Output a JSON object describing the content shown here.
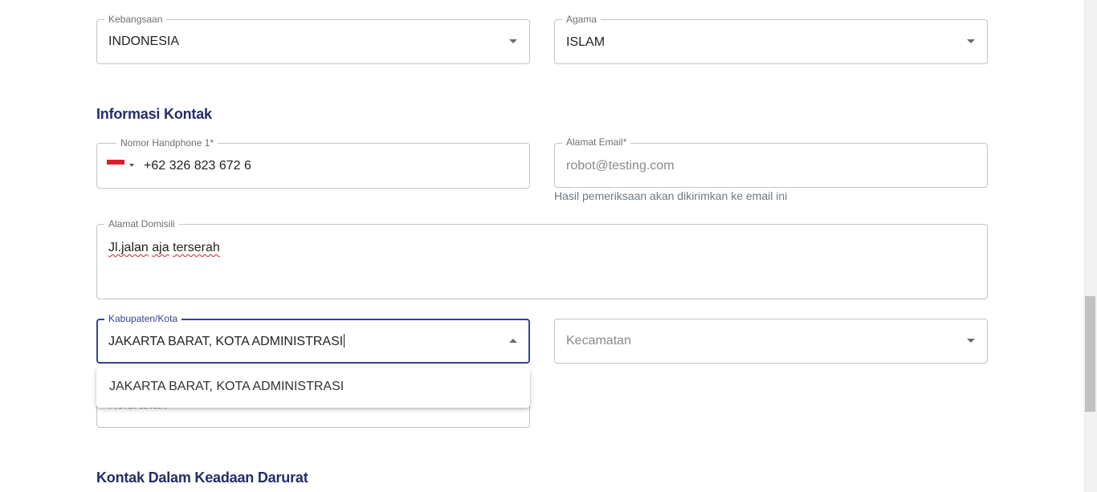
{
  "personal": {
    "nationality": {
      "label": "Kebangsaan",
      "value": "INDONESIA"
    },
    "religion": {
      "label": "Agama",
      "value": "ISLAM"
    }
  },
  "contact_section": {
    "title": "Informasi Kontak",
    "phone": {
      "label": "Nomor Handphone 1*",
      "value": "+62 326 823 672 6",
      "flag": "indonesia-flag"
    },
    "email": {
      "label": "Alamat Email*",
      "placeholder": "robot@testing.com",
      "helper": "Hasil pemeriksaan akan dikirimkan ke email ini"
    },
    "address": {
      "label": "Alamat Domisili",
      "words": [
        "Jl.jalan",
        "aja",
        "terserah"
      ]
    },
    "city": {
      "label": "Kabupaten/Kota",
      "value": "JAKARTA BARAT, KOTA ADMINISTRASI"
    },
    "district": {
      "placeholder": "Kecamatan"
    },
    "subdistrict": {
      "placeholder": "Kelurahan"
    },
    "city_dropdown": {
      "options": [
        "JAKARTA BARAT, KOTA ADMINISTRASI"
      ]
    }
  },
  "emergency_section": {
    "title": "Kontak Dalam Keadaan Darurat"
  },
  "colors": {
    "accent": "#3a3f99",
    "heading": "#252c6b",
    "flag_red": "#d6202b"
  }
}
